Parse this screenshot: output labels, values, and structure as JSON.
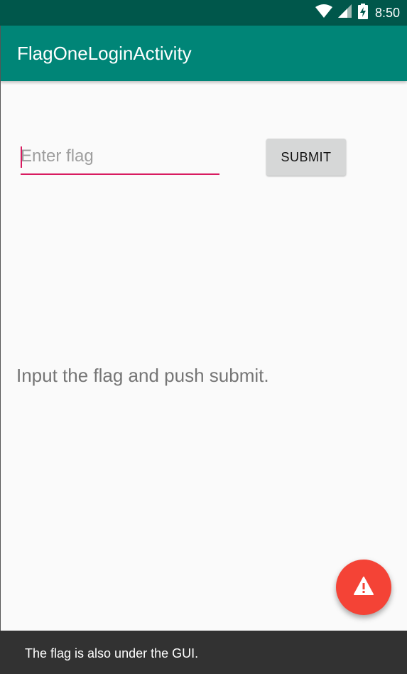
{
  "status_bar": {
    "time": "8:50",
    "icons": [
      "wifi-icon",
      "signal-icon",
      "battery-charging-icon"
    ]
  },
  "app_bar": {
    "title": "FlagOneLoginActivity"
  },
  "form": {
    "flag_input": {
      "value": "",
      "placeholder": "Enter flag"
    },
    "submit_label": "SUBMIT"
  },
  "main": {
    "hint_text": "Input the flag and push submit."
  },
  "fab": {
    "icon": "warning-icon"
  },
  "snackbar": {
    "message": "The flag is also under the GUI."
  },
  "colors": {
    "status_bar": "#00574b",
    "app_bar": "#008577",
    "accent": "#d81b60",
    "fab": "#f44336",
    "snackbar": "#323232"
  }
}
